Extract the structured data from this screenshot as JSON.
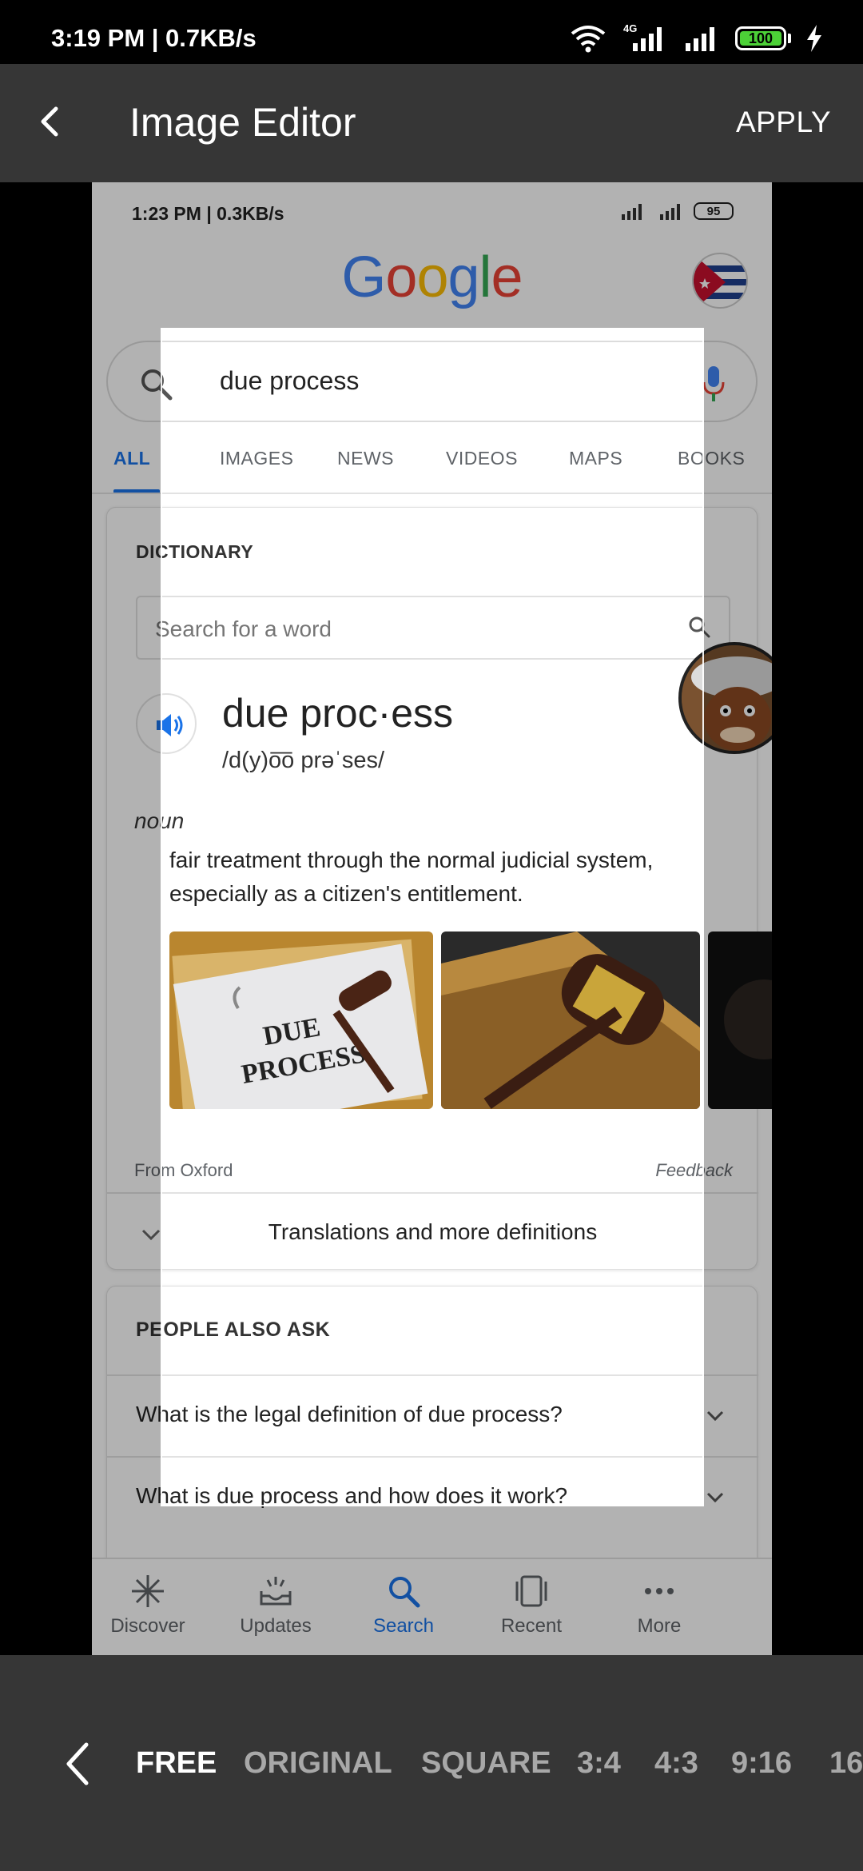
{
  "status_bar": {
    "time": "3:19 PM | 0.7KB/s",
    "battery": "100",
    "network": "4G"
  },
  "toolbar": {
    "title": "Image Editor",
    "apply_label": "APPLY",
    "back_icon": "back-arrow-icon"
  },
  "screenshot": {
    "status_time": "1:23 PM | 0.3KB/s",
    "status_battery": "95",
    "logo_letters": [
      "G",
      "o",
      "o",
      "g",
      "l",
      "e"
    ],
    "search_query": "due process",
    "tabs": [
      "ALL",
      "IMAGES",
      "NEWS",
      "VIDEOS",
      "MAPS",
      "BOOKS"
    ],
    "active_tab": "ALL",
    "dictionary": {
      "label": "DICTIONARY",
      "search_placeholder": "Search for a word",
      "headword": "due proc·ess",
      "pronunciation": "/d(y)o͞o prəˈses/",
      "part_of_speech": "noun",
      "definition": "fair treatment through the normal judicial system, especially as a citizen's entitlement.",
      "image_text_line1": "DUE",
      "image_text_line2": "PROCESS",
      "source": "From Oxford",
      "feedback": "Feedback",
      "more_link": "Translations and more definitions"
    },
    "people_also_ask": {
      "label": "PEOPLE ALSO ASK",
      "questions": [
        "What is the legal definition of due process?",
        "What is due process and how does it work?"
      ]
    },
    "bottom_nav": [
      {
        "label": "Discover",
        "icon": "asterisk-icon"
      },
      {
        "label": "Updates",
        "icon": "updates-icon"
      },
      {
        "label": "Search",
        "icon": "search-icon"
      },
      {
        "label": "Recent",
        "icon": "recent-icon"
      },
      {
        "label": "More",
        "icon": "more-dots-icon"
      }
    ],
    "active_nav": "Search"
  },
  "aspect_ratios": {
    "options": [
      "FREE",
      "ORIGINAL",
      "SQUARE",
      "3:4",
      "4:3",
      "9:16",
      "16"
    ],
    "selected": "FREE"
  },
  "colors": {
    "toolbar_bg": "#363636",
    "accent_blue": "#1a73e8",
    "battery_green": "#4cd137"
  }
}
